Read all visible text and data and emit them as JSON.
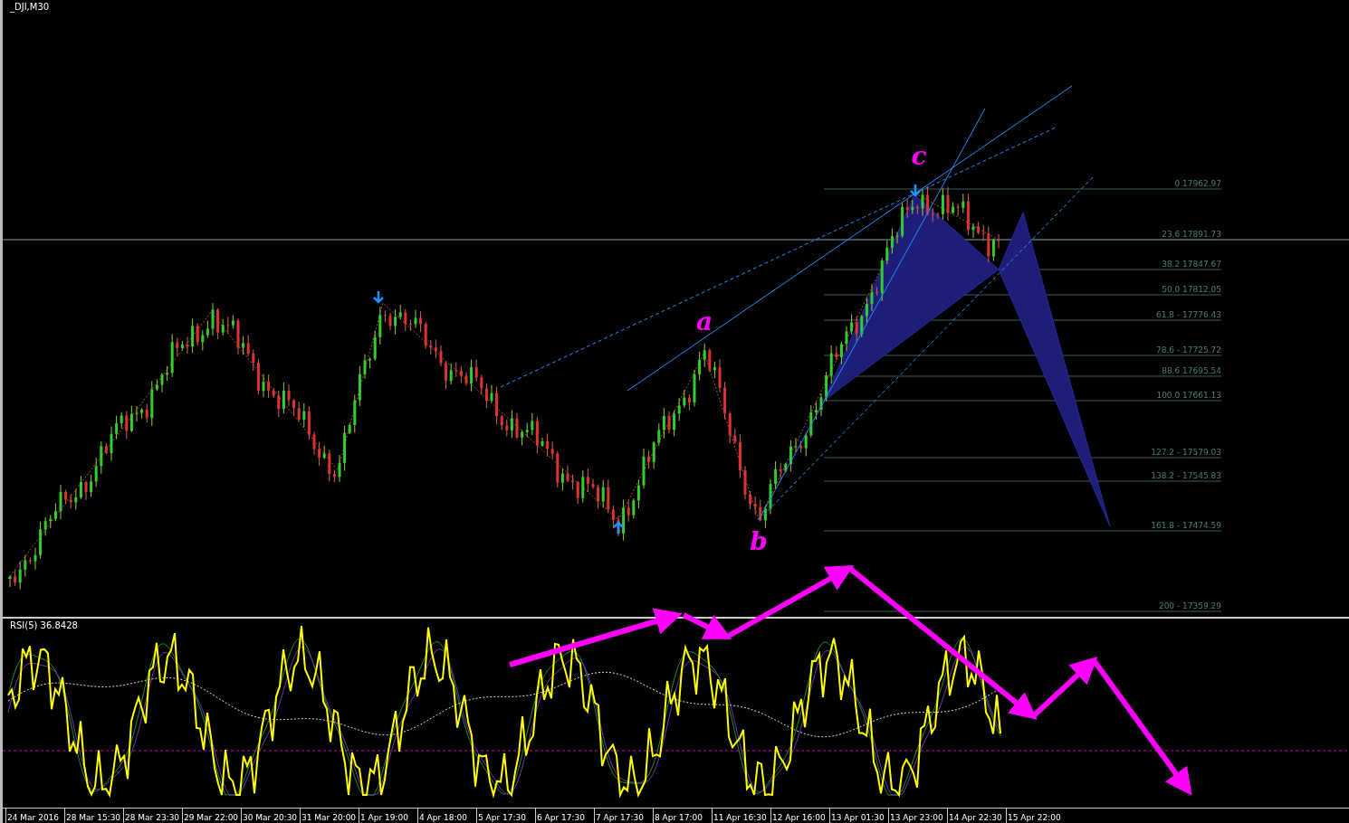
{
  "chart": {
    "symbol_label": "_DJI,M30",
    "wave_labels": [
      "a",
      "b",
      "c"
    ],
    "fib_levels": [
      {
        "label": "0 17962.97"
      },
      {
        "label": "23.6 17891.73"
      },
      {
        "label": "38.2 17847.67"
      },
      {
        "label": "50.0 17812.05"
      },
      {
        "label": "61.8 - 17776.43"
      },
      {
        "label": "78.6 - 17725.72"
      },
      {
        "label": "88.6 17695.54"
      },
      {
        "label": "100.0 17661.13"
      },
      {
        "label": "127.2 - 17579.03"
      },
      {
        "label": "138.2 - 17545.83"
      },
      {
        "label": "161.8 - 17474.59"
      },
      {
        "label": "200 - 17359.29"
      }
    ]
  },
  "rsi": {
    "label": "RSI(5) 36.8428"
  },
  "time_axis": {
    "labels": [
      "24 Mar 2016",
      "28 Mar 15:30",
      "28 Mar 23:30",
      "29 Mar 22:00",
      "30 Mar 20:30",
      "31 Mar 20:00",
      "1 Apr 19:00",
      "4 Apr 18:00",
      "5 Apr 17:30",
      "6 Apr 17:30",
      "7 Apr 17:30",
      "8 Apr 17:00",
      "11 Apr 16:30",
      "12 Apr 16:00",
      "13 Apr 01:30",
      "13 Apr 23:00",
      "14 Apr 22:30",
      "15 Apr 22:00"
    ]
  }
}
